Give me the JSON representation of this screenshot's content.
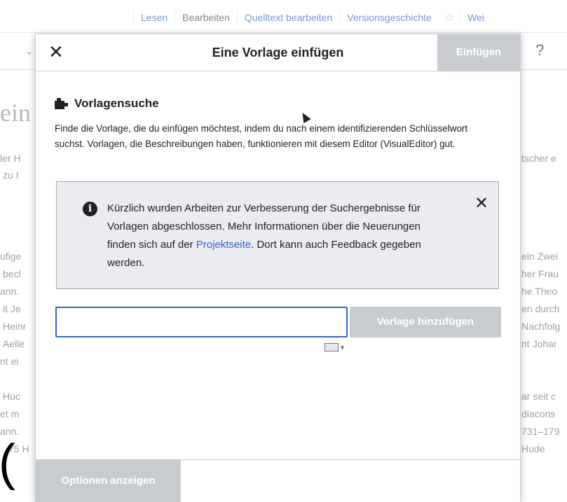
{
  "page": {
    "tabs": [
      "Lesen",
      "Bearbeiten",
      "Quelltext bearbeiten",
      "Versionsgeschichte",
      "Wei"
    ],
    "heading_fragment": "ein",
    "left_fragments": [
      "ler H",
      "zu I",
      "ufige",
      "becl",
      "ann.",
      "it Je",
      "Heinr",
      "Aelle",
      "nt ei",
      "Huc",
      "et m",
      "ann.",
      "75 H"
    ],
    "right_fragments": [
      "tscher e",
      "ein Zwei",
      "her Frau",
      "he Theo",
      "en durch",
      "Nachfolg",
      "nt Johar",
      "ar seit c",
      "diacons",
      "731–179",
      "Hude"
    ]
  },
  "dialog": {
    "title": "Eine Vorlage einfügen",
    "insert_label": "Einfügen",
    "section_title": "Vorlagensuche",
    "description": "Finde die Vorlage, die du einfügen möchtest, indem du nach einem identifizierenden Schlüsselwort suchst. Vorlagen, die Beschreibungen haben, funktionieren mit diesem Editor (VisualEditor) gut.",
    "notice": {
      "text_before": "Kürzlich wurden Arbeiten zur Verbesserung der Suchergebnisse für Vorlagen abgeschlossen. Mehr Informationen über die Neuerungen finden sich auf der",
      "link": "Projektseite",
      "text_after": ". Dort kann auch Feedback gegeben werden."
    },
    "search": {
      "value": "",
      "placeholder": ""
    },
    "add_template_label": "Vorlage hinzufügen",
    "options_label": "Optionen anzeigen"
  },
  "colors": {
    "accent": "#3366cc",
    "disabled": "#c8ccd1",
    "notice_bg": "#eaecf0"
  }
}
